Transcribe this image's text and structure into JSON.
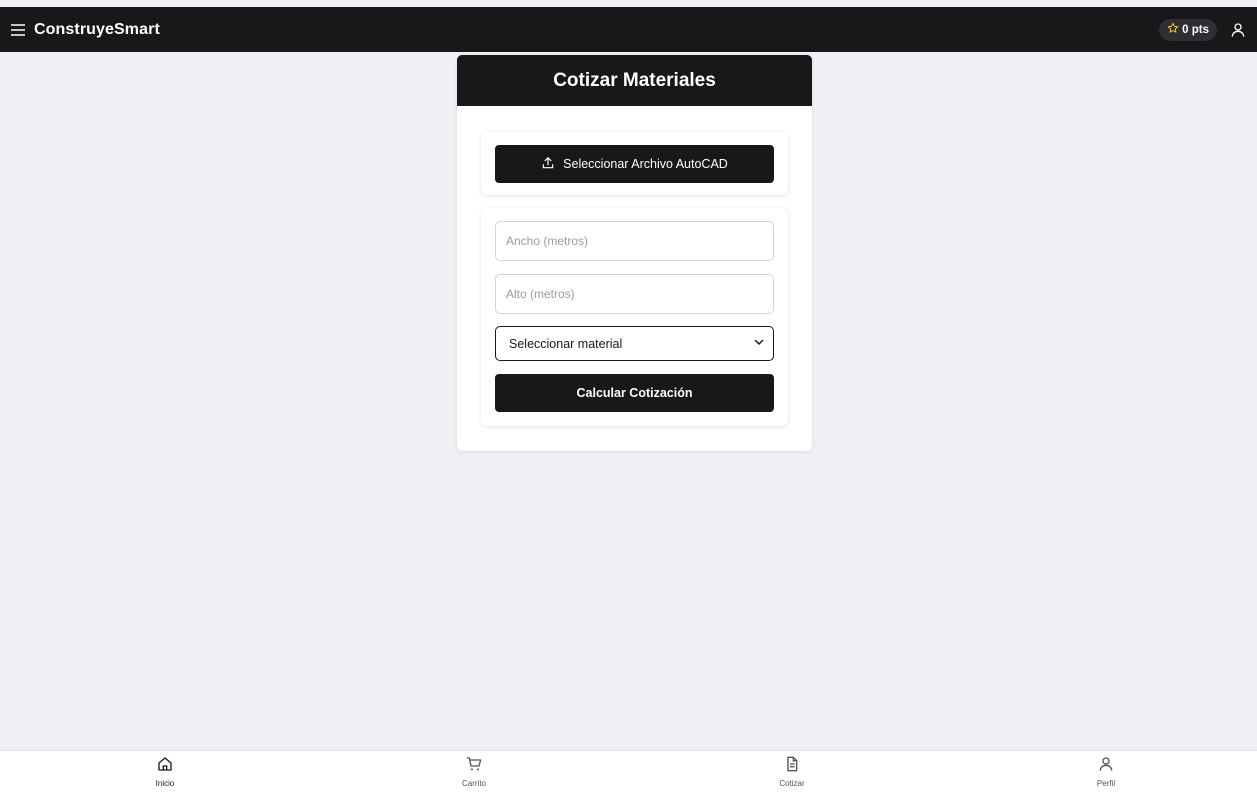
{
  "app": {
    "title": "ConstruyeSmart"
  },
  "header": {
    "points_label": "0 pts",
    "accent_color": "#f5c518"
  },
  "quote_form": {
    "title": "Cotizar Materiales",
    "upload_label": "Seleccionar Archivo AutoCAD",
    "width_placeholder": "Ancho (metros)",
    "height_placeholder": "Alto (metros)",
    "material_select": "Seleccionar material",
    "submit_label": "Calcular Cotización"
  },
  "bottom_nav": {
    "items": [
      {
        "label": "Inicio",
        "icon": "home-icon",
        "active": true
      },
      {
        "label": "Carrito",
        "icon": "cart-icon",
        "active": false
      },
      {
        "label": "Cotizar",
        "icon": "document-icon",
        "active": false
      },
      {
        "label": "Perfil",
        "icon": "user-icon",
        "active": false
      }
    ]
  },
  "colors": {
    "dark": "#18181b",
    "background": "#f0f0f4"
  }
}
